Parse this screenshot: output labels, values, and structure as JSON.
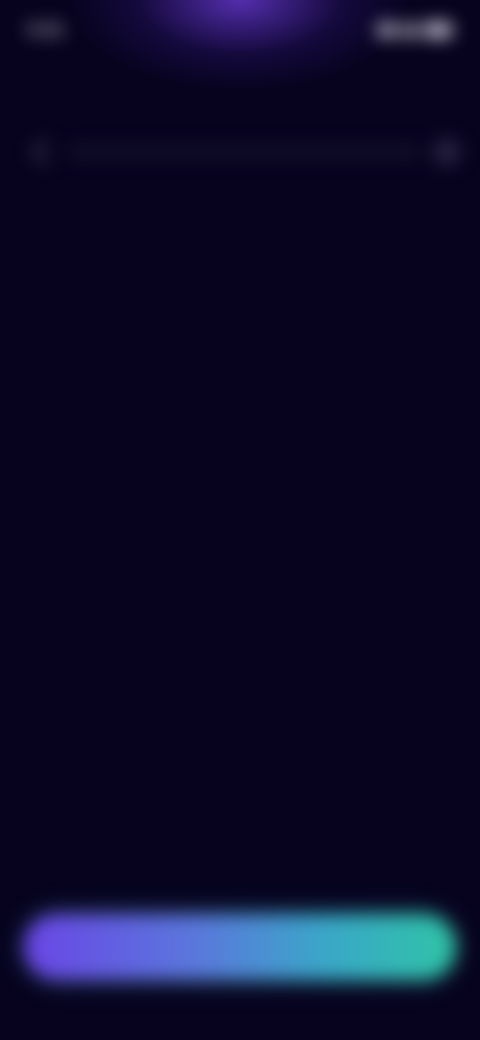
{
  "status_bar": {
    "time": "9:41"
  },
  "progress": {
    "value": 0.0
  },
  "main": {
    "headline": "",
    "subline": ""
  },
  "cta": {
    "label": ""
  },
  "colors": {
    "background": "#07031f",
    "glow": "#6e3cdc",
    "cta_gradient_start": "#6a45e6",
    "cta_gradient_end": "#2fc4a6"
  },
  "icons": [
    "signal-icon",
    "wifi-icon",
    "battery-icon",
    "back-icon",
    "close-icon"
  ]
}
